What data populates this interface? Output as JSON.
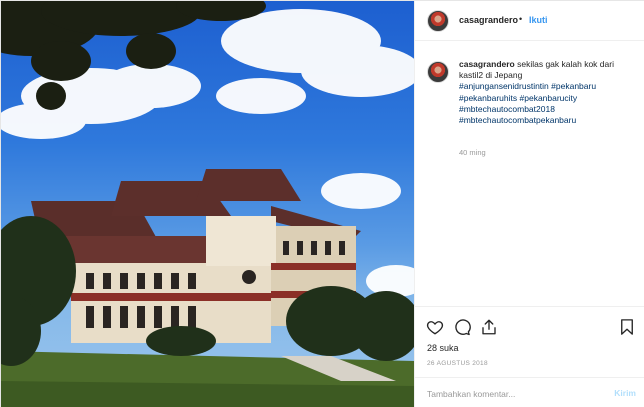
{
  "post": {
    "username": "casagrandero",
    "separator": "•",
    "follow_label": "Ikuti",
    "caption": {
      "username": "casagrandero",
      "text": " sekilas gak kalah kok dari kastil2 di Jepang",
      "hashtags": [
        "#anjungansenidrustintin",
        "#pekanbaru",
        "#pekanbaruhits",
        "#pekanbarucity",
        "#mbtechautocombat2018",
        "#mbtechautocombatpekanbaru"
      ]
    },
    "time_ago": "40 ming",
    "likes": "28 suka",
    "date": "26 AGUSTUS 2018",
    "comment": {
      "placeholder": "Tambahkan komentar...",
      "value": "",
      "post_label": "Kirim"
    },
    "icons": {
      "like": "heart-icon",
      "comment": "comment-icon",
      "share": "share-icon",
      "save": "bookmark-icon"
    },
    "colors": {
      "link": "#003569",
      "follow": "#3897f0",
      "muted": "#999999",
      "post_button_disabled": "#b2dffc"
    }
  }
}
